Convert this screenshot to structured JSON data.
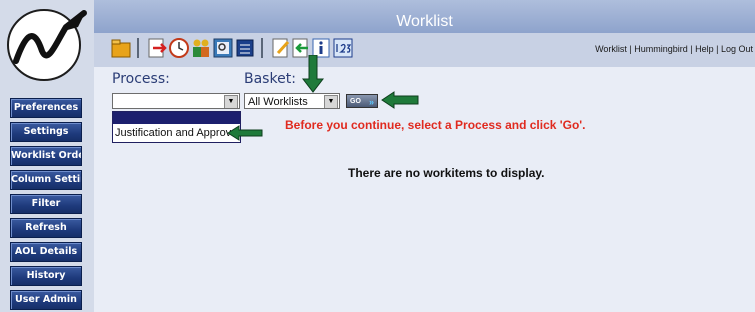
{
  "header": {
    "title": "Worklist"
  },
  "top_links": "Worklist | Hummingbird | Help | Log Out",
  "sidebar": {
    "items": [
      {
        "label": "Preferences"
      },
      {
        "label": "Settings"
      },
      {
        "label": "Worklist Order"
      },
      {
        "label": "Column Settings"
      },
      {
        "label": "Filter"
      },
      {
        "label": "Refresh"
      },
      {
        "label": "AOL Details"
      },
      {
        "label": "History"
      },
      {
        "label": "User Admin"
      }
    ]
  },
  "toolbar": {
    "icons": [
      "folder-icon",
      "export-icon",
      "clock-icon",
      "users-icon",
      "search-doc-icon",
      "calendar-icon",
      "edit-icon",
      "import-icon",
      "info-icon",
      "numbering-icon"
    ]
  },
  "form": {
    "process_label": "Process:",
    "process_value": "",
    "process_options": [
      "",
      "Justification and Approval"
    ],
    "basket_label": "Basket:",
    "basket_value": "All Worklists",
    "go_label": "GO"
  },
  "messages": {
    "warning": "Before you continue, select a Process and click 'Go'.",
    "empty": "There are no workitems to display."
  },
  "colors": {
    "sidebar_button": "#1e3a7c",
    "title_bar": "#8ea3cc",
    "warning": "#e02a1f",
    "annotation_arrow": "#1f7a3a"
  }
}
